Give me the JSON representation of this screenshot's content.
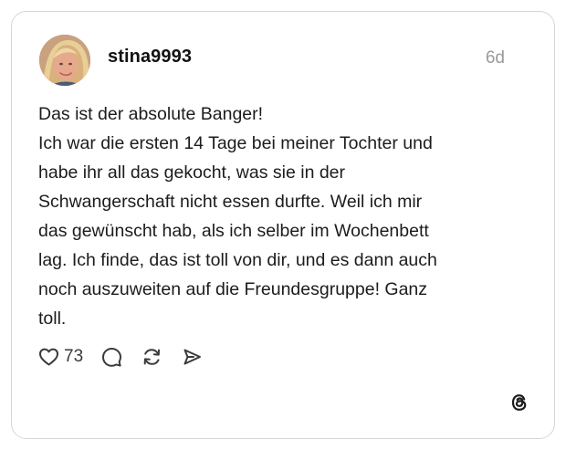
{
  "post": {
    "username": "stina9993",
    "timestamp": "6d",
    "lines": [
      "Das ist der absolute Banger!",
      "Ich war die ersten 14 Tage bei meiner Tochter und",
      "habe ihr all das gekocht, was sie in der",
      "Schwangerschaft nicht essen durfte. Weil ich mir",
      "das gewünscht hab, als ich selber im Wochenbett",
      "lag. Ich finde, das ist toll von dir, und es dann auch",
      "noch auszuweiten auf die Freundesgruppe!  Ganz",
      "toll."
    ],
    "like_count": "73"
  },
  "icons": {
    "like": "heart-icon",
    "comment": "comment-icon",
    "repost": "repost-icon",
    "share": "send-icon",
    "brand": "threads-logo-icon"
  },
  "colors": {
    "card_border": "#d6d6d6",
    "text": "#1c1c1c",
    "muted": "#9a9a9a",
    "icon": "#3a3a3a"
  }
}
